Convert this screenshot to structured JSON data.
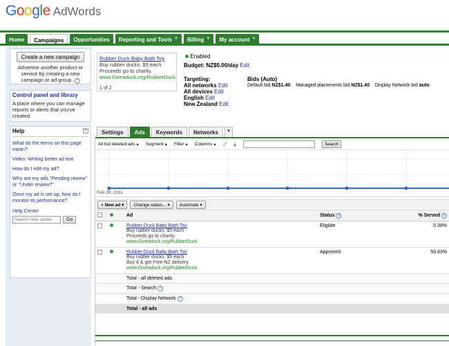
{
  "brand": {
    "google": "Google",
    "product": "AdWords"
  },
  "nav": {
    "tabs": [
      {
        "label": "Home"
      },
      {
        "label": "Campaigns"
      },
      {
        "label": "Opportunities"
      },
      {
        "label": "Reporting and Tools"
      },
      {
        "label": "Billing"
      },
      {
        "label": "My account"
      }
    ]
  },
  "sidebar": {
    "create_button": "Create a new campaign",
    "create_desc": "Advertise another product or service by creating a new campaign or ad group.",
    "control_title": "Control panel and library",
    "control_desc": "A place where you can manage reports or alerts that you've created.",
    "help_title": "Help",
    "help_items": [
      "What do the terms on this page mean?",
      "Video: Writing better ad text",
      "How do I edit my ad?",
      "Why are my ads \"Pending review\" or \"Under review?\"",
      "Once my ad is set up, how do I monitor its performance?"
    ],
    "help_center": "Help Center",
    "search_placeholder": "Search help center",
    "go": "Go"
  },
  "preview": {
    "title": "Rubber Duck Baby Bath Toy",
    "line1": "Buy rubber ducks. $5 each",
    "line2": "Proceeds go to charity.",
    "url": "www.Giveaduck.org/RubberDuck",
    "pager": "1 of 2"
  },
  "campaign": {
    "status": "Enabled",
    "budget_label": "Budget:",
    "budget_value": "NZ$5.00/day",
    "edit": "Edit",
    "targeting_label": "Targeting:",
    "targeting": [
      "All networks",
      "All devices",
      "English",
      "New Zealand"
    ],
    "bids_label": "Bids (Auto)",
    "default_bid_label": "Default bid",
    "default_bid": "NZ$1.40",
    "placements_label": "Managed placements bid",
    "placements_bid": "NZ$1.40",
    "display_label": "Display Network bid",
    "display_bid": "auto"
  },
  "tabs": [
    "Settings",
    "Ads",
    "Keywords",
    "Networks"
  ],
  "filters": {
    "all_but_deleted": "All but deleted ads",
    "segment": "Segment",
    "filter": "Filter",
    "columns": "Columns",
    "search_btn": "Search"
  },
  "chart": {
    "date_label": "Feb 28, 2011"
  },
  "toolbar": {
    "new_ad": "+ New ad",
    "change_status": "Change status...",
    "automate": "Automate"
  },
  "table": {
    "headers": {
      "ad": "Ad",
      "status": "Status",
      "served": "% Served"
    },
    "rows": [
      {
        "title": "Rubber Duck Baby Bath Toy",
        "line1": "Buy rubber ducks. $5 each",
        "line2": "Proceeds go to charity.",
        "url": "www.Giveaduck.org/RubberDuck",
        "status": "Eligible",
        "served": "0.38%"
      },
      {
        "title": "Rubber Duck Baby Bath Toy",
        "line1": "Buy rubber ducks. $5 each",
        "line2": "Buy 4 & get Free NZ delivery",
        "url": "www.Giveaduck.org/RubberDuck",
        "status": "Approved",
        "served": "50.83%"
      }
    ],
    "totals": [
      "Total - all deleted ads",
      "Total - Search",
      "Total - Display Network",
      "Total - all ads"
    ]
  },
  "colors": {
    "nav_green": "#2f7d2f",
    "link_blue": "#1b2ea0",
    "url_green": "#1a8a1a",
    "enabled_dot": "#2aa52a"
  }
}
